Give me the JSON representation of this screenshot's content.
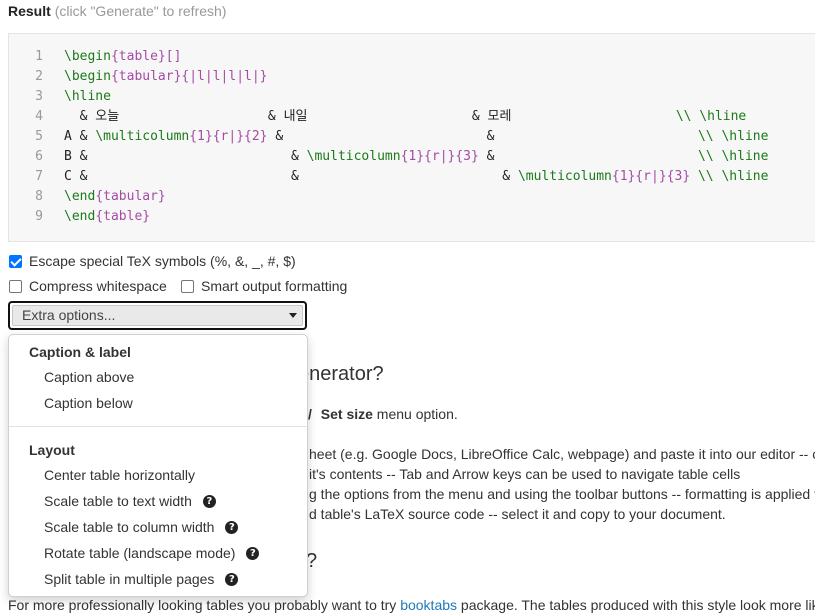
{
  "result": {
    "title": "Result",
    "hint": "(click \"Generate\" to refresh)"
  },
  "code_lines": [
    {
      "n": "1",
      "parts": [
        [
          "cmd",
          "\\begin"
        ],
        [
          "arg",
          "{table}[]"
        ]
      ]
    },
    {
      "n": "2",
      "parts": [
        [
          "cmd",
          "\\begin"
        ],
        [
          "arg",
          "{tabular}{|l|l|l|l|}"
        ]
      ]
    },
    {
      "n": "3",
      "parts": [
        [
          "cmd",
          "\\hline"
        ]
      ]
    },
    {
      "n": "4",
      "parts": [
        [
          "txt",
          "  & 오늘                   & 내일                     & 모레                     "
        ],
        [
          "cmd",
          "\\\\ \\hline"
        ]
      ]
    },
    {
      "n": "5",
      "parts": [
        [
          "txt",
          "A & "
        ],
        [
          "cmd",
          "\\multicolumn"
        ],
        [
          "arg",
          "{1}{r|}{2}"
        ],
        [
          "txt",
          " &                          &                          "
        ],
        [
          "cmd",
          "\\\\ \\hline"
        ]
      ]
    },
    {
      "n": "6",
      "parts": [
        [
          "txt",
          "B &                          & "
        ],
        [
          "cmd",
          "\\multicolumn"
        ],
        [
          "arg",
          "{1}{r|}{3}"
        ],
        [
          "txt",
          " &                          "
        ],
        [
          "cmd",
          "\\\\ \\hline"
        ]
      ]
    },
    {
      "n": "7",
      "parts": [
        [
          "txt",
          "C &                          &                          & "
        ],
        [
          "cmd",
          "\\multicolumn"
        ],
        [
          "arg",
          "{1}{r|}{3}"
        ],
        [
          "txt",
          " "
        ],
        [
          "cmd",
          "\\\\ \\hline"
        ]
      ]
    },
    {
      "n": "8",
      "parts": [
        [
          "cmd",
          "\\end"
        ],
        [
          "arg",
          "{tabular}"
        ]
      ]
    },
    {
      "n": "9",
      "parts": [
        [
          "cmd",
          "\\end"
        ],
        [
          "arg",
          "{table}"
        ]
      ]
    }
  ],
  "options": {
    "escape_label": "Escape special TeX symbols (%, &, _, #, $)",
    "escape_checked": true,
    "compress_label": "Compress whitespace",
    "compress_checked": false,
    "smart_label": "Smart output formatting",
    "smart_checked": false
  },
  "extra_select": {
    "value": "Extra options..."
  },
  "dropdown": {
    "group1_label": "Caption & label",
    "group1_items": [
      "Caption above",
      "Caption below"
    ],
    "group2_label": "Layout",
    "group2_items": [
      {
        "label": "Center table horizontally",
        "help": false
      },
      {
        "label": "Scale table to text width",
        "help": true
      },
      {
        "label": "Scale table to column width",
        "help": true
      },
      {
        "label": "Rotate table (landscape mode)",
        "help": true
      },
      {
        "label": "Split table in multiple pages",
        "help": true
      }
    ],
    "help_glyph": "?"
  },
  "background": {
    "heading1": "enerator?",
    "line1_sep": "/",
    "line1_bold": "Set size",
    "line1_rest": " menu option.",
    "para1": "heet (e.g. Google Docs, LibreOffice Calc, webpage) and paste it into our editor -- cl",
    "para2": "it's contents -- Tab and Arrow keys can be used to navigate table cells",
    "para3": "g the options from the menu and using the toolbar buttons -- formatting is applied t",
    "para4": "d table's LaTeX source code -- select it and copy to your document.",
    "heading2": "?",
    "bottom_pre": "For more professionally looking tables you probably want to try ",
    "bottom_link": "booktabs",
    "bottom_post": " package. The tables produced with this style look more lik"
  }
}
